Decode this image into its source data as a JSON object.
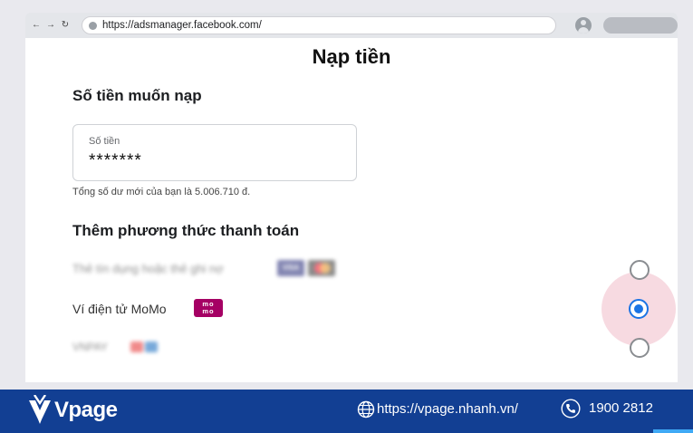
{
  "browser": {
    "back_icon": "arrow-left-icon",
    "forward_icon": "arrow-right-icon",
    "reload_icon": "reload-icon",
    "url": "https://adsmanager.facebook.com/"
  },
  "dialog": {
    "title": "Nạp tiền",
    "amount_section": {
      "heading": "Số tiền muốn nạp",
      "field_label": "Số tiền",
      "field_value": "*******",
      "balance_note": "Tổng số dư mới của bạn là 5.006.710 đ."
    },
    "payment_section": {
      "heading": "Thêm phương thức thanh toán",
      "options": [
        {
          "label": "Thẻ tín dụng hoặc thẻ ghi nợ",
          "logos": [
            "VISA",
            "Mastercard"
          ],
          "selected": false
        },
        {
          "label": "Ví điện tử MoMo",
          "logo_text": "mo mo",
          "selected": true
        },
        {
          "label": "VNPAY",
          "selected": false
        }
      ]
    }
  },
  "footer": {
    "brand": "Vpage",
    "website": "https://vpage.nhanh.vn/",
    "phone": "1900 2812"
  },
  "colors": {
    "accent": "#1b74e4",
    "footer_bg": "#123f93",
    "momo": "#a50064"
  }
}
